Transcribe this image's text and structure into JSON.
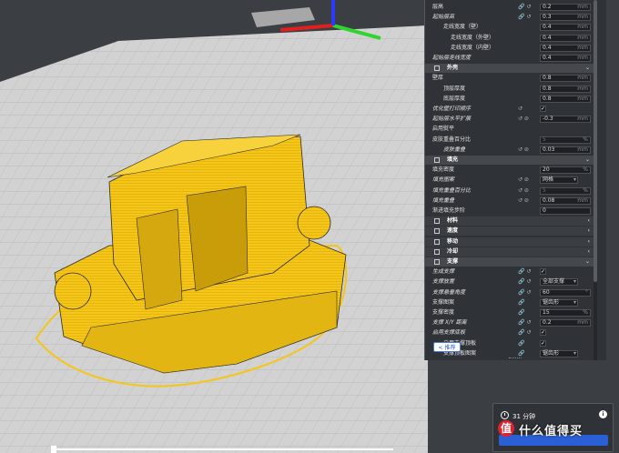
{
  "panel": {
    "rows": [
      {
        "label": "层高",
        "indent": 0,
        "italic": false,
        "value": "0.2",
        "unit": "mm",
        "icons": "🔗 ↺"
      },
      {
        "label": "起始层高",
        "indent": 0,
        "italic": true,
        "value": "0.3",
        "unit": "mm",
        "icons": "🔗 ↺"
      },
      {
        "label": "走线宽度（壁）",
        "indent": 1,
        "italic": false,
        "value": "0.4",
        "unit": "mm",
        "icons": ""
      },
      {
        "label": "走线宽度（外壁）",
        "indent": 2,
        "italic": false,
        "value": "0.4",
        "unit": "mm",
        "icons": ""
      },
      {
        "label": "走线宽度（内壁）",
        "indent": 2,
        "italic": false,
        "value": "0.4",
        "unit": "mm",
        "icons": ""
      },
      {
        "label": "起始层走线宽度",
        "indent": 0,
        "italic": true,
        "value": "0.4",
        "unit": "mm",
        "icons": ""
      }
    ],
    "sections": [
      {
        "title": "外壳",
        "collapsed": false
      },
      {
        "title": "填充",
        "collapsed": false
      },
      {
        "title": "材料",
        "collapsed": true
      },
      {
        "title": "速度",
        "collapsed": true
      },
      {
        "title": "移动",
        "collapsed": true
      },
      {
        "title": "冷却",
        "collapsed": true
      },
      {
        "title": "支撑",
        "collapsed": false
      }
    ],
    "shell_rows": [
      {
        "label": "壁厚",
        "indent": 0,
        "italic": false,
        "value": "0.8",
        "unit": "mm"
      },
      {
        "label": "顶层厚度",
        "indent": 1,
        "italic": false,
        "value": "0.8",
        "unit": "mm"
      },
      {
        "label": "底层厚度",
        "indent": 1,
        "italic": false,
        "value": "0.8",
        "unit": "mm"
      },
      {
        "label": "优化壁打印顺序",
        "indent": 0,
        "italic": true,
        "check": "✓",
        "icons": "↺"
      },
      {
        "label": "起始层水平扩展",
        "indent": 0,
        "italic": true,
        "value": "-0.3",
        "unit": "mm",
        "icons": "↺ ⊘"
      },
      {
        "label": "启用熨平",
        "indent": 0,
        "italic": false,
        "value": "",
        "unit": ""
      },
      {
        "label": "皮肤重叠百分比",
        "indent": 0,
        "italic": false,
        "value": "5",
        "unit": "%",
        "disabled": true
      },
      {
        "label": "皮肤重叠",
        "indent": 1,
        "italic": true,
        "value": "0.03",
        "unit": "mm",
        "icons": "↺ ⊘"
      }
    ],
    "infill_rows": [
      {
        "label": "填充密度",
        "indent": 0,
        "italic": false,
        "value": "20",
        "unit": "%"
      },
      {
        "label": "填充图案",
        "indent": 0,
        "italic": true,
        "select": "网格",
        "icons": "↺ ⊘"
      },
      {
        "label": "填充重叠百分比",
        "indent": 0,
        "italic": true,
        "value": "5",
        "unit": "%",
        "icons": "↺ ⊘",
        "disabled": true
      },
      {
        "label": "填充重叠",
        "indent": 0,
        "italic": true,
        "value": "0.08",
        "unit": "mm",
        "icons": "↺ ⊘"
      },
      {
        "label": "渐进填充步阶",
        "indent": 0,
        "italic": false,
        "value": "0",
        "unit": ""
      }
    ],
    "support_rows": [
      {
        "label": "生成支撑",
        "indent": 0,
        "italic": true,
        "check": "✓",
        "icons": "🔗 ↺"
      },
      {
        "label": "支撑放置",
        "indent": 0,
        "italic": true,
        "select": "全部支撑",
        "icons": "🔗 ↺"
      },
      {
        "label": "支撑悬垂角度",
        "indent": 0,
        "italic": true,
        "value": "60",
        "unit": "°",
        "icons": "🔗 ↺"
      },
      {
        "label": "支撑图案",
        "indent": 0,
        "italic": false,
        "select": "锯齿形",
        "icons": "🔗"
      },
      {
        "label": "支撑密度",
        "indent": 0,
        "italic": false,
        "value": "15",
        "unit": "%",
        "icons": "🔗"
      },
      {
        "label": "支撑 X/Y 距离",
        "indent": 0,
        "italic": true,
        "value": "0.2",
        "unit": "mm",
        "icons": "🔗 ↺"
      },
      {
        "label": "启用支撑底板",
        "indent": 0,
        "italic": true,
        "check": "✓",
        "icons": "🔗 ↺"
      },
      {
        "label": "启用支撑顶板",
        "indent": 1,
        "italic": false,
        "check": "✓",
        "icons": "🔗"
      },
      {
        "label": "支撑顶板图案",
        "indent": 1,
        "italic": false,
        "select": "锯齿形",
        "icons": "🔗"
      }
    ],
    "recommended_label": "< 推荐"
  },
  "print_card": {
    "time": "31 分钟",
    "info": "i"
  },
  "watermark": {
    "text": "什么值得买",
    "badge": "值"
  },
  "colors": {
    "model_yellow": "#f5c518",
    "axis_x": "#e11f1f",
    "axis_y": "#2ed52e",
    "axis_z": "#2a3bff",
    "slice_button": "#2b5fd6"
  }
}
